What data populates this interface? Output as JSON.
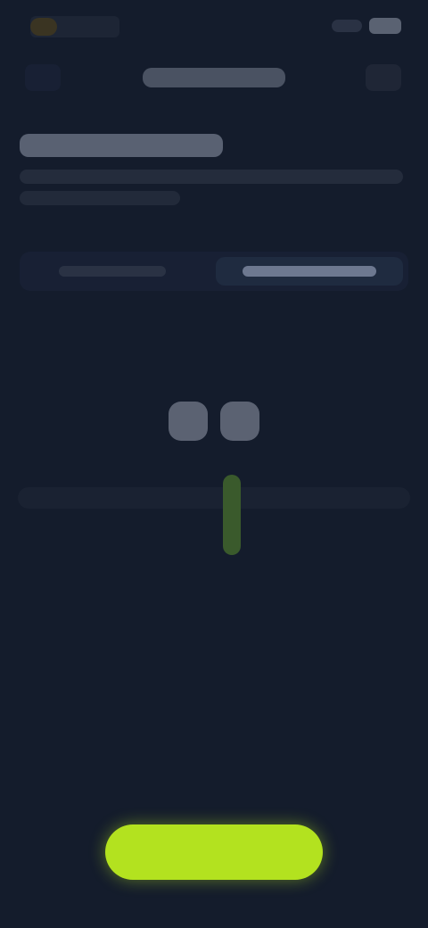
{
  "status_bar": {
    "time": "",
    "battery": ""
  },
  "nav": {
    "title": ""
  },
  "header": {
    "heading": "",
    "description": ""
  },
  "segment": {
    "options": [
      "",
      ""
    ],
    "selected_index": 1
  },
  "value": {
    "display": ""
  },
  "actions": {
    "continue_label": ""
  },
  "colors": {
    "background": "#141c2c",
    "accent": "#b3e21f"
  }
}
